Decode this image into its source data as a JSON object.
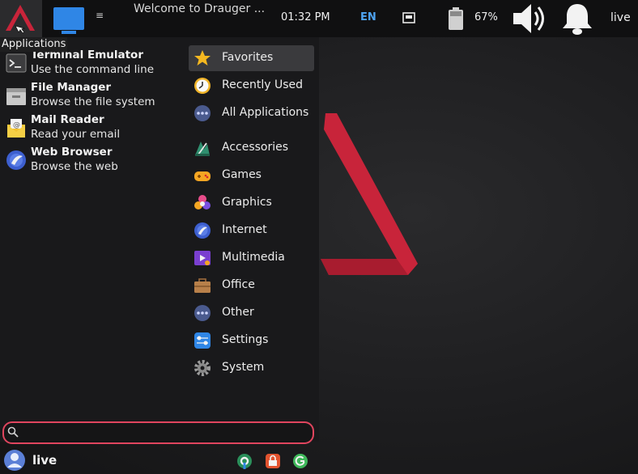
{
  "top_panel": {
    "apps_tooltip": "Applications",
    "task_more": "≡",
    "window_title": "Welcome to Drauger ...",
    "clock": "01:32 PM",
    "keyboard_layout": "EN",
    "battery_percent": "67%",
    "user": "live"
  },
  "favorites": [
    {
      "name": "Terminal Emulator",
      "description": "Use the command line",
      "icon": "terminal-icon"
    },
    {
      "name": "File Manager",
      "description": "Browse the file system",
      "icon": "folder-icon"
    },
    {
      "name": "Mail Reader",
      "description": "Read your email",
      "icon": "mail-icon"
    },
    {
      "name": "Web Browser",
      "description": "Browse the web",
      "icon": "globe-icon"
    }
  ],
  "categories": [
    {
      "label": "Favorites",
      "icon": "star-icon",
      "selected": true
    },
    {
      "label": "Recently Used",
      "icon": "clock-icon"
    },
    {
      "label": "All Applications",
      "icon": "dots-icon"
    },
    {
      "label": "Accessories",
      "icon": "accessories-icon"
    },
    {
      "label": "Games",
      "icon": "gamepad-icon"
    },
    {
      "label": "Graphics",
      "icon": "graphics-icon"
    },
    {
      "label": "Internet",
      "icon": "globe-icon"
    },
    {
      "label": "Multimedia",
      "icon": "multimedia-icon"
    },
    {
      "label": "Office",
      "icon": "briefcase-icon"
    },
    {
      "label": "Other",
      "icon": "dots-icon"
    },
    {
      "label": "Settings",
      "icon": "settings-icon"
    },
    {
      "label": "System",
      "icon": "gear-icon"
    }
  ],
  "search": {
    "value": "",
    "placeholder": ""
  },
  "menu_user": {
    "name": "live"
  },
  "colors": {
    "accent": "#e0455e",
    "brand_red": "#c8243a",
    "highlight": "#3a3a3d"
  }
}
